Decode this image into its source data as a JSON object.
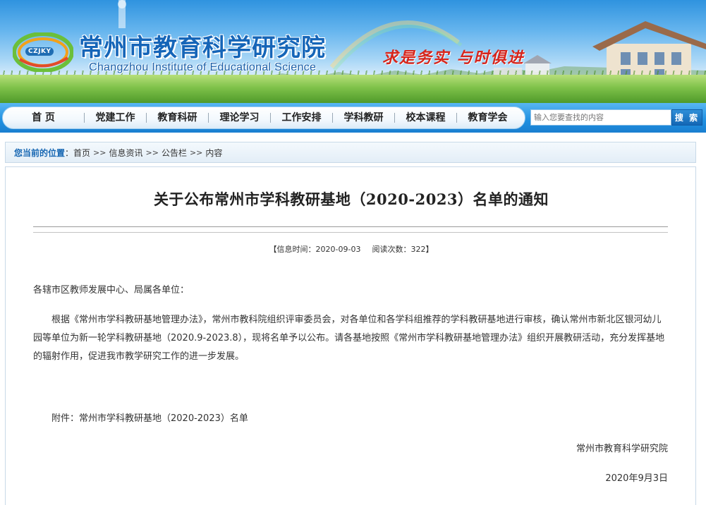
{
  "header": {
    "logo_text": "CZJKY",
    "site_title": "常州市教育科学研究院",
    "site_subtitle": "Changzhou Institute of Educational Science",
    "slogan": "求是务实  与时俱进"
  },
  "nav": {
    "items": [
      {
        "label": "首  页"
      },
      {
        "label": "党建工作"
      },
      {
        "label": "教育科研"
      },
      {
        "label": "理论学习"
      },
      {
        "label": "工作安排"
      },
      {
        "label": "学科教研"
      },
      {
        "label": "校本课程"
      },
      {
        "label": "教育学会"
      }
    ],
    "search_placeholder": "输入您要查找的内容",
    "search_button": "搜 索"
  },
  "breadcrumb": {
    "label": "您当前的位置",
    "colon": "：",
    "items": [
      "首页",
      "信息资讯",
      "公告栏",
      "内容"
    ],
    "separator": ">>"
  },
  "article": {
    "title": "关于公布常州市学科教研基地（2020-2023）名单的通知",
    "meta": {
      "open": "【",
      "time_label": "信息时间：",
      "time_value": "2020-09-03",
      "views_label": "阅读次数：",
      "views_value": "322",
      "close": "】"
    },
    "salutation": "各辖市区教师发展中心、局属各单位：",
    "body": "根据《常州市学科教研基地管理办法》，常州市教科院组织评审委员会，对各单位和各学科组推荐的学科教研基地进行审核，确认常州市新北区银河幼儿园等单位为新一轮学科教研基地（2020.9-2023.8），现将名单予以公布。请各基地按照《常州市学科教研基地管理办法》组织开展教研活动，充分发挥基地的辐射作用，促进我市教学研究工作的进一步发展。",
    "attachment": "附件：常州市学科教研基地（2020-2023）名单",
    "signature": "常州市教育科学研究院",
    "date": "2020年9月3日"
  },
  "colors": {
    "nav_blue": "#1f8fe0",
    "title_blue": "#1565b8",
    "slogan_red": "#d6251c",
    "breadcrumb_label": "#1767b3"
  }
}
